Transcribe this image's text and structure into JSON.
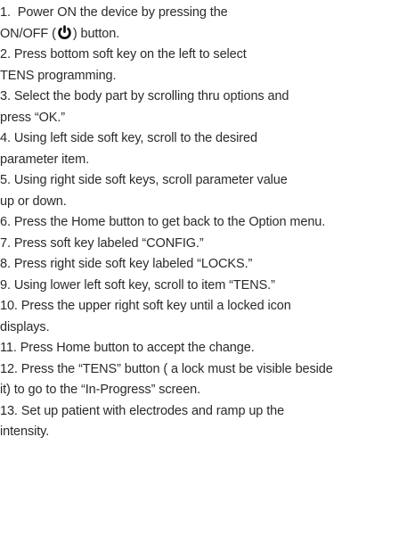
{
  "steps": [
    {
      "number": "1.",
      "lines": [
        "Power ON the device by pressing the"
      ],
      "line2_pre": "ON/OFF (",
      "line2_icon": "power-icon",
      "line2_post": ") button."
    },
    {
      "number": "2.",
      "lines": [
        "Press bottom soft key on the left to select",
        "TENS programming."
      ]
    },
    {
      "number": "3.",
      "lines": [
        "Select the body part by scrolling thru options and",
        "press “OK.”"
      ]
    },
    {
      "number": "4.",
      "lines": [
        "Using left side soft key, scroll to the desired",
        "parameter item."
      ]
    },
    {
      "number": "5.",
      "lines": [
        "Using right side soft keys, scroll parameter value",
        "up or down."
      ]
    },
    {
      "number": "6.",
      "lines": [
        "Press the Home button to get back to the Option menu."
      ]
    },
    {
      "number": "7.",
      "lines": [
        "Press soft key labeled “CONFIG.”"
      ]
    },
    {
      "number": "8.",
      "lines": [
        "Press right side soft key labeled “LOCKS.”"
      ]
    },
    {
      "number": "9.",
      "lines": [
        "Using lower left soft key, scroll to item “TENS.”"
      ]
    },
    {
      "number": "10.",
      "lines": [
        "Press the upper right soft key until a locked icon",
        "displays."
      ]
    },
    {
      "number": "11.",
      "lines": [
        "Press Home button to accept the change."
      ]
    },
    {
      "number": "12.",
      "lines": [
        "Press the “TENS” button ( a lock must be visible beside",
        "it) to go to the “In-Progress” screen."
      ]
    },
    {
      "number": "13.",
      "lines": [
        "Set up patient with electrodes and ramp up the",
        "intensity."
      ]
    }
  ]
}
